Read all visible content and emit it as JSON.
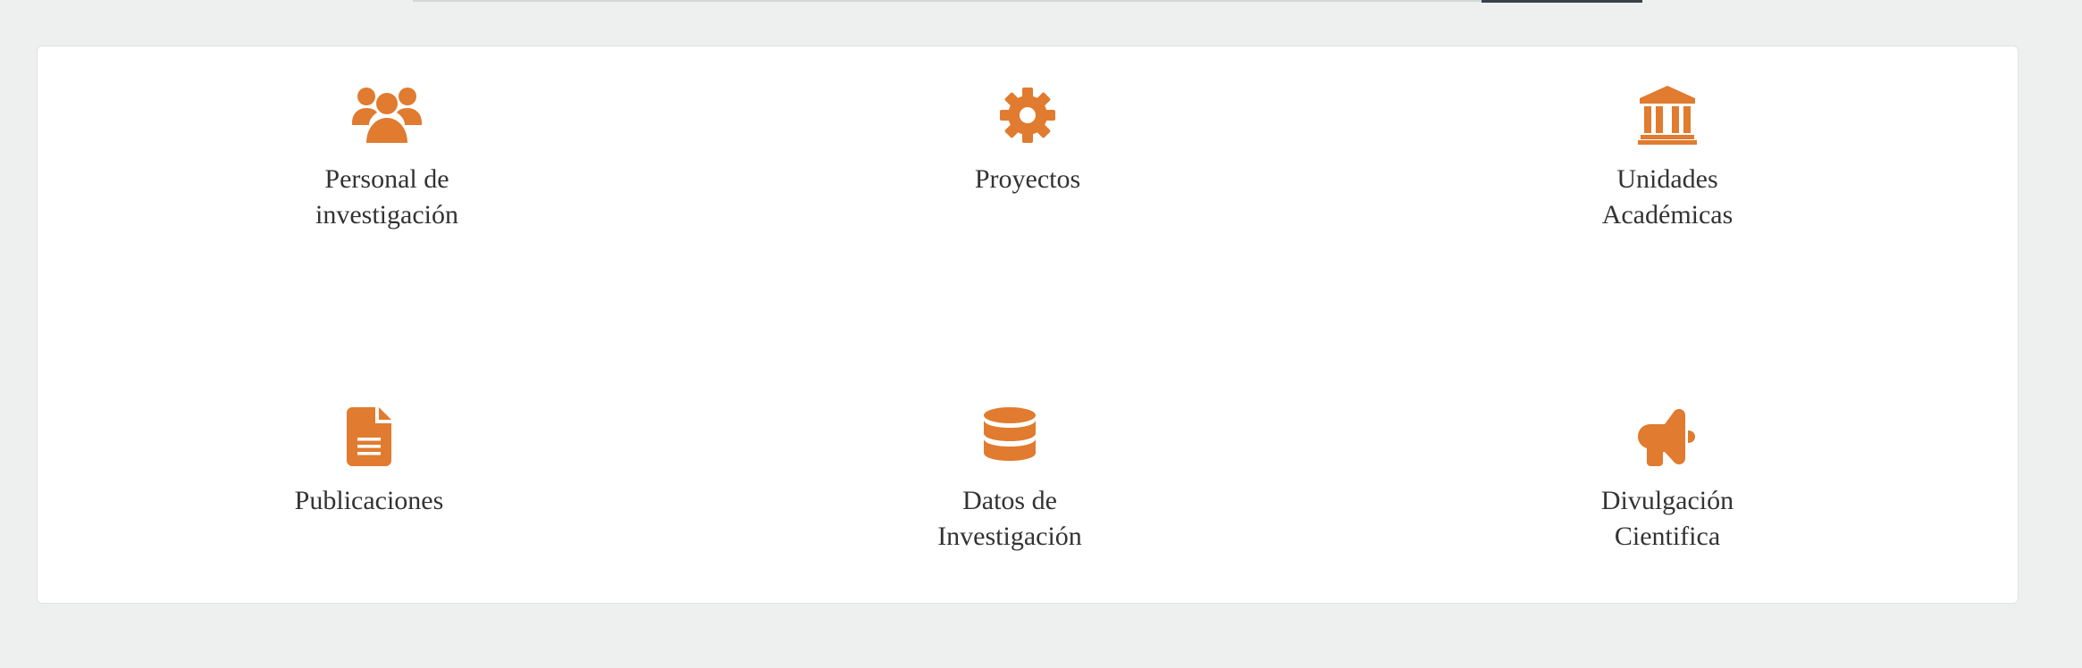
{
  "colors": {
    "accent": "#e07b2f",
    "page_background": "#eef0ef",
    "card_background": "#ffffff",
    "text": "#333333"
  },
  "categories": [
    {
      "id": "personal",
      "icon": "users-icon",
      "line1": "Personal de",
      "line2": "investigación"
    },
    {
      "id": "proyectos",
      "icon": "gear-icon",
      "line1": "Proyectos",
      "line2": ""
    },
    {
      "id": "unidades",
      "icon": "institution-icon",
      "line1": "Unidades",
      "line2": "Académicas"
    },
    {
      "id": "publicaciones",
      "icon": "file-icon",
      "line1": "Publicaciones",
      "line2": ""
    },
    {
      "id": "datos",
      "icon": "database-icon",
      "line1": "Datos de",
      "line2": "Investigación"
    },
    {
      "id": "divulgacion",
      "icon": "megaphone-icon",
      "line1": "Divulgación",
      "line2": "Cientifica"
    }
  ]
}
